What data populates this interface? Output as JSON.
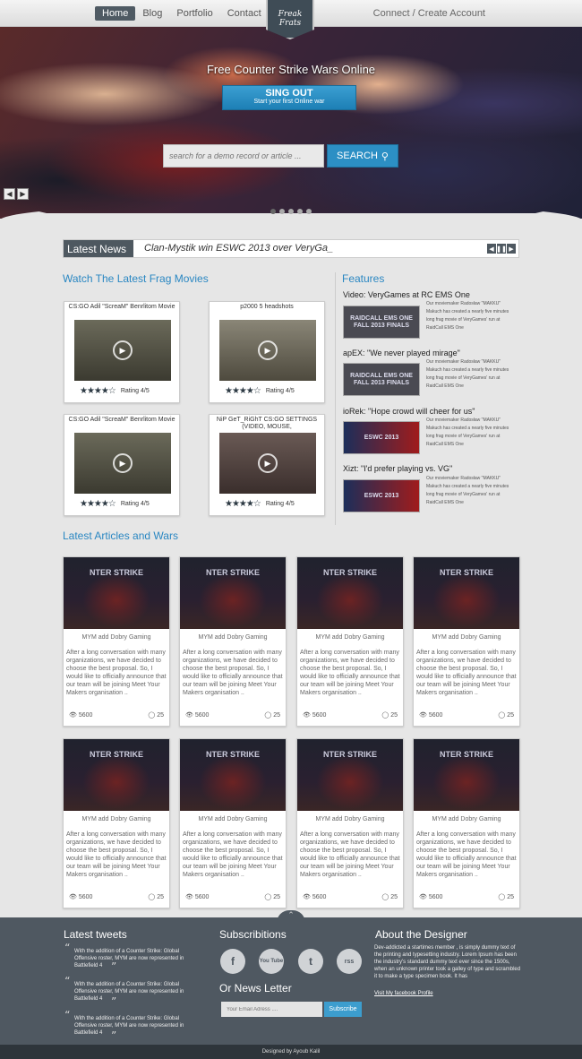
{
  "nav": {
    "items": [
      "Home",
      "Blog",
      "Portfolio",
      "Contact"
    ],
    "connect": "Connect / Create Account",
    "logo": "Freak Frats"
  },
  "hero": {
    "title": "Free Counter Strike Wars Online",
    "signout_label": "SING OUT",
    "signout_sub": "Start your first Online war",
    "search_placeholder": "search for a demo record or article ...",
    "search_label": "SEARCH"
  },
  "news": {
    "label": "Latest News",
    "text": "Clan-Mystik win ESWC 2013 over VeryGa_"
  },
  "movies": {
    "heading": "Watch The Latest Frag Movies",
    "items": [
      {
        "title": "CS:GO Adil \"ScreaM\" Benrlitom Movie",
        "rating": "Rating 4/5",
        "stars": 4
      },
      {
        "title": "p2000 5 headshots",
        "rating": "Rating 4/5",
        "stars": 4
      },
      {
        "title": "CS:GO Adil \"ScreaM\" Benrlitom Movie",
        "rating": "Rating 4/5",
        "stars": 4
      },
      {
        "title": "NiP GeT_RiGhT CS:GO SETTINGS (VIDEO, MOUSE,",
        "rating": "Rating 4/5",
        "stars": 4
      }
    ]
  },
  "features": {
    "heading": "Features",
    "items": [
      {
        "title": "Video: VeryGames at RC EMS One",
        "img": "RAIDCALL EMS ONE FALL 2013 FINALS",
        "desc": "Our moviemaker Radosław \"MAKKU\" Makuch has created a nearly five minutes long frag movie of VeryGames' run at RaidCall EMS One"
      },
      {
        "title": "apEX: \"We never played mirage\"",
        "img": "RAIDCALL EMS ONE FALL 2013 FINALS",
        "desc": "Our moviemaker Radosław \"MAKKU\" Makuch has created a nearly five minutes long frag movie of VeryGames' run at RaidCall EMS One"
      },
      {
        "title": "ioRek: \"Hope crowd will cheer for us\"",
        "img": "ESWC 2013",
        "desc": "Our moviemaker Radosław \"MAKKU\" Makuch has created a nearly five minutes long frag movie of VeryGames' run at RaidCall EMS One"
      },
      {
        "title": "Xizt: \"I'd prefer playing vs. VG\"",
        "img": "ESWC 2013",
        "desc": "Our moviemaker Radosław \"MAKKU\" Makuch has created a nearly five minutes long frag movie of VeryGames' run at RaidCall EMS One"
      }
    ]
  },
  "articles": {
    "heading": "Latest Articles and Wars",
    "title": "MYM add Dobry Gaming",
    "body": "After a long conversation with many organizations, we have decided to choose the best proposal. So, I would like to officially announce that our team will be joining Meet Your Makers organisation ..",
    "views": "5600",
    "comments": "25",
    "banner": "NTER STRIKE"
  },
  "footer": {
    "tweets_heading": "Latest tweets",
    "tweet": "With the addition of a Counter Strike: Global Offensive roster, MYM are now represented in Battlefield 4",
    "subs_heading": "Subscribitions",
    "social": [
      "f",
      "You Tube",
      "t",
      "rss"
    ],
    "newsletter_heading": "Or News Letter",
    "email_placeholder": "Your Email Adress ....",
    "subscribe_label": "Subscribe",
    "about_heading": "About the Designer",
    "about_text": "Dev-addicted a startimes member , is simply dummy text of the printing and typesetting industry. Lorem Ipsum has been the industry's standard dummy text ever since the 1500s, when an unknown printer took a galley of type and scrambled it to make a type specimen book. It has",
    "about_link": "Visit My facebook Profile",
    "credit": "Designed by Ayoub Kalil"
  }
}
